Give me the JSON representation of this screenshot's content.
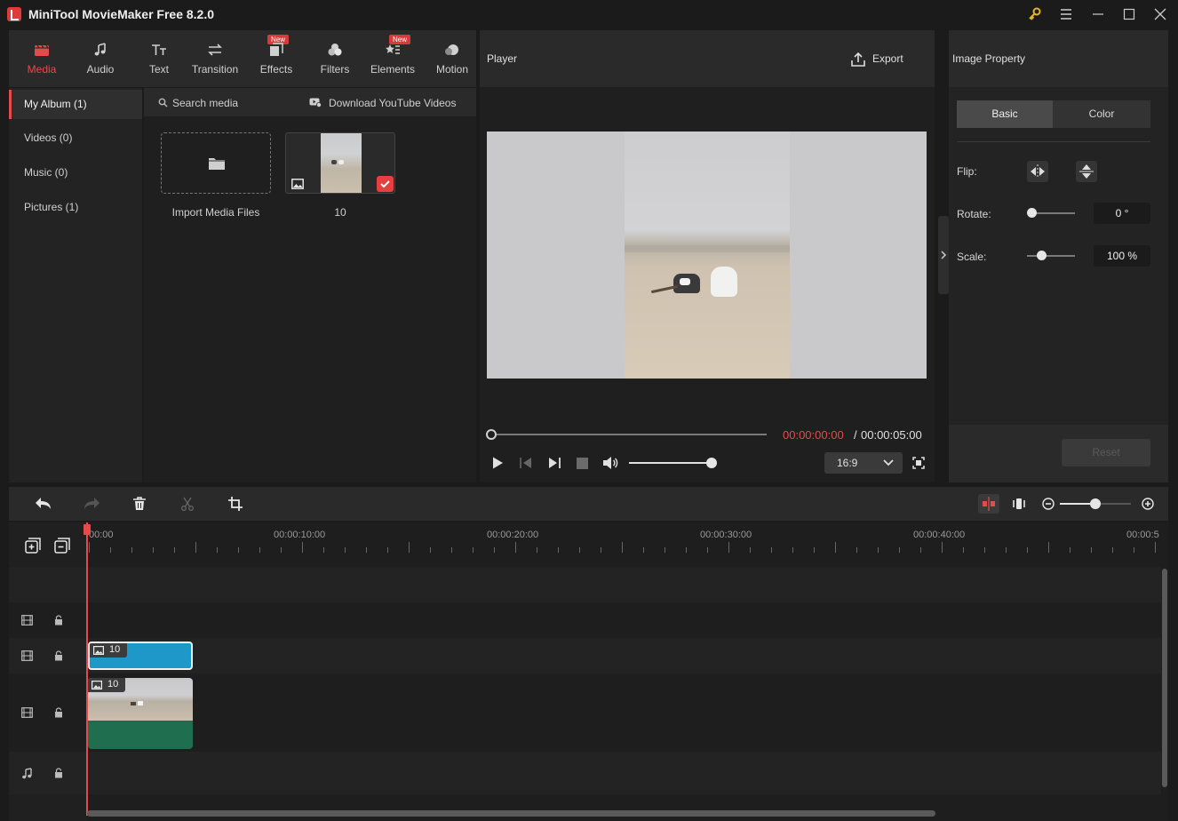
{
  "window": {
    "title": "MiniTool MovieMaker Free 8.2.0"
  },
  "top_tabs": [
    {
      "label": "Media",
      "icon": "media-icon",
      "new": false,
      "active": true
    },
    {
      "label": "Audio",
      "icon": "music-icon",
      "new": false,
      "active": false
    },
    {
      "label": "Text",
      "icon": "text-icon",
      "new": false,
      "active": false
    },
    {
      "label": "Transition",
      "icon": "transition-icon",
      "new": false,
      "active": false
    },
    {
      "label": "Effects",
      "icon": "effects-icon",
      "new": true,
      "active": false
    },
    {
      "label": "Filters",
      "icon": "filters-icon",
      "new": false,
      "active": false
    },
    {
      "label": "Elements",
      "icon": "elements-icon",
      "new": true,
      "active": false
    },
    {
      "label": "Motion",
      "icon": "motion-icon",
      "new": false,
      "active": false
    }
  ],
  "new_badge": "New",
  "sidebar": {
    "items": [
      {
        "label": "My Album (1)",
        "active": true
      },
      {
        "label": "Videos (0)",
        "active": false
      },
      {
        "label": "Music (0)",
        "active": false
      },
      {
        "label": "Pictures (1)",
        "active": false
      }
    ]
  },
  "media": {
    "search_label": "Search media",
    "download_label": "Download YouTube Videos",
    "import_label": "Import Media Files",
    "items": [
      {
        "name": "10",
        "selected": true
      }
    ]
  },
  "player": {
    "title": "Player",
    "export_label": "Export",
    "current_time": "00:00:00:00",
    "separator": "/",
    "total_time": "00:00:05:00",
    "aspect_ratio": "16:9",
    "progress": 0.0,
    "volume": 1.0
  },
  "property": {
    "title": "Image Property",
    "tabs": [
      {
        "label": "Basic",
        "active": true
      },
      {
        "label": "Color",
        "active": false
      }
    ],
    "flip_label": "Flip:",
    "rotate_label": "Rotate:",
    "rotate_value": "0 °",
    "rotate_level": 0.0,
    "scale_label": "Scale:",
    "scale_value": "100 %",
    "scale_level": 0.3,
    "reset_label": "Reset"
  },
  "timeline": {
    "ruler": [
      "00:00",
      "00:00:10:00",
      "00:00:20:00",
      "00:00:30:00",
      "00:00:40:00",
      "00:00:5"
    ],
    "clips": [
      {
        "label": "10"
      },
      {
        "label": "10"
      }
    ],
    "zoom_level": 0.5
  },
  "colors": {
    "accent": "#e54b4b",
    "clip_blue": "#1e98c9",
    "clip_green": "#1f6e4f",
    "background": "#1b1b1b"
  }
}
